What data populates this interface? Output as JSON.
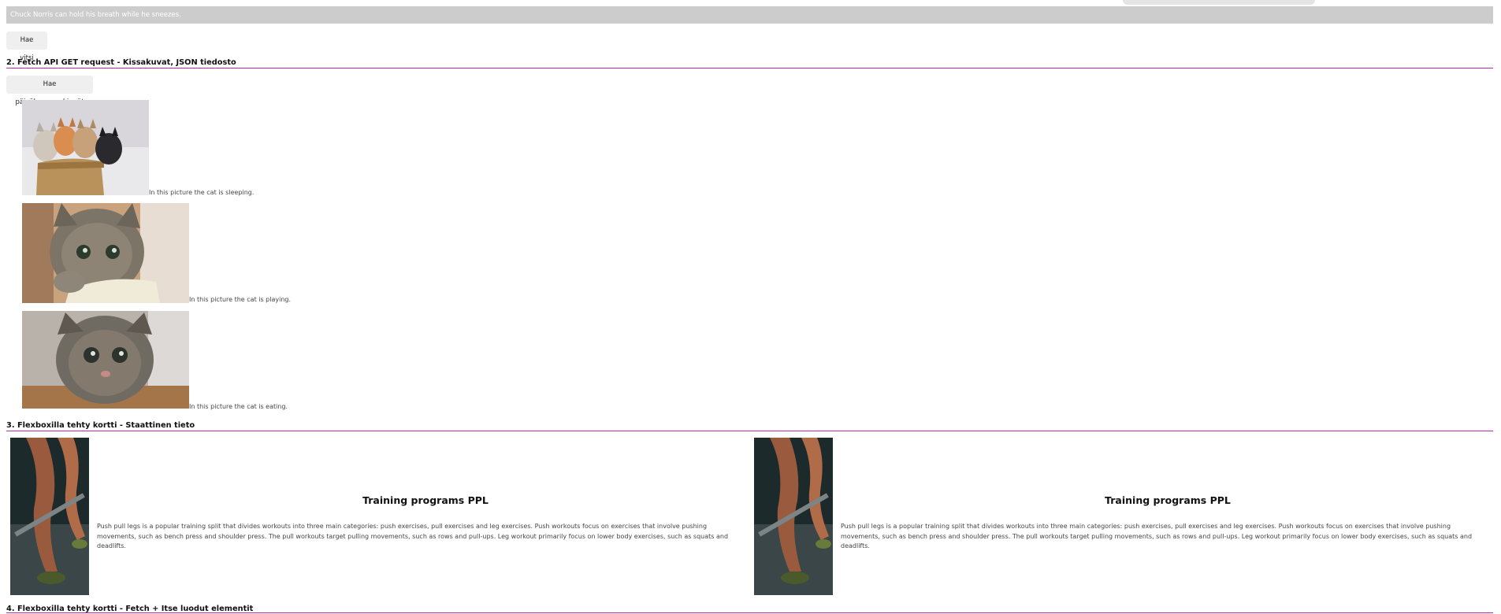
{
  "joke": {
    "text": "Chuck Norris can hold his breath while he sneezes."
  },
  "section1": {
    "button_label": "Hae vitsi"
  },
  "section2": {
    "title": "2. Fetch API GET request - Kissakuvat, JSON tiedosto",
    "button_label": "Hae päiväkuvamerkinnät",
    "cats": [
      {
        "caption": "In this picture the cat is sleeping."
      },
      {
        "caption": "In this picture the cat is playing."
      },
      {
        "caption": "In this picture the cat is eating."
      }
    ]
  },
  "section3": {
    "title": "3. Flexboxilla tehty kortti - Staattinen tieto",
    "cards": [
      {
        "title": "Training programs PPL",
        "text": "Push pull legs is a popular training split that divides workouts into three main categories: push exercises, pull exercises and leg exercises. Push workouts focus on exercises that involve pushing movements, such as bench press and shoulder press. The pull workouts target pulling movements, such as rows and pull-ups. Leg workout primarily focus on lower body exercises, such as squats and deadlifts."
      },
      {
        "title": "Training programs PPL",
        "text": "Push pull legs is a popular training split that divides workouts into three main categories: push exercises, pull exercises and leg exercises. Push workouts focus on exercises that involve pushing movements, such as bench press and shoulder press. The pull workouts target pulling movements, such as rows and pull-ups. Leg workout primarily focus on lower body exercises, such as squats and deadlifts."
      }
    ]
  },
  "section4": {
    "title": "4. Flexboxilla tehty kortti - Fetch + Itse luodut elementit"
  },
  "colors": {
    "accent_rule": "#c025a8",
    "joke_bar": "#cdcccc",
    "button_bg": "#efefef"
  }
}
